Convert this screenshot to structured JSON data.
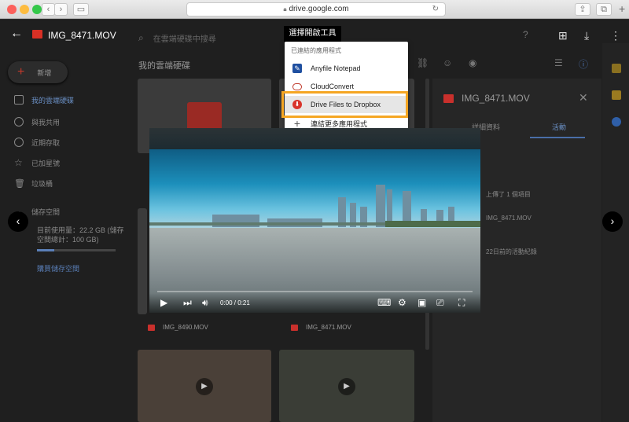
{
  "browser": {
    "url": "drive.google.com"
  },
  "header": {
    "file_title": "IMG_8471.MOV",
    "search_placeholder": "在雲端硬碟中搜尋",
    "open_with_label": "選擇開啟工具"
  },
  "menu": {
    "section_title": "已連結的應用程式",
    "items": [
      {
        "label": "Anyfile Notepad",
        "icon": "notepad-icon"
      },
      {
        "label": "CloudConvert",
        "icon": "cloudconvert-icon"
      },
      {
        "label": "Drive Files to Dropbox",
        "icon": "dropbox-transfer-icon"
      },
      {
        "label": "連結更多應用程式",
        "icon": "plus-icon"
      }
    ]
  },
  "sidebar": {
    "new_label": "新增",
    "breadcrumb": "我的雲端硬碟",
    "items": [
      {
        "label": "我的雲端硬碟"
      },
      {
        "label": "與我共用"
      },
      {
        "label": "近期存取"
      },
      {
        "label": "已加星號"
      },
      {
        "label": "垃圾桶"
      },
      {
        "label": "儲存空間"
      }
    ],
    "storage_text": "目前使用量：22.2 GB (儲存空間總計：100 GB)",
    "buy_storage": "購買儲存空間"
  },
  "files": [
    {
      "name": "IMG_8490.MOV"
    },
    {
      "name": "IMG_8471.MOV"
    }
  ],
  "details": {
    "file_title": "IMG_8471.MOV",
    "tab_details": "詳細資料",
    "tab_activity": "活動",
    "activity_line1": "上傳了 1 個項目",
    "activity_file": "IMG_8471.MOV",
    "activity_line2": "22日前的活動紀錄"
  },
  "video": {
    "time": "0:00 / 0:21",
    "progress": 0
  },
  "colors": {
    "highlight": "#f5a623",
    "file_red": "#c9302c"
  }
}
